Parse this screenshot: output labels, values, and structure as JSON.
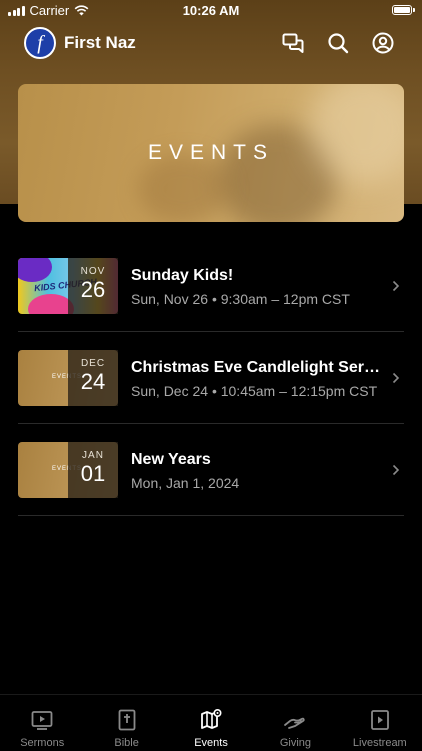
{
  "status_bar": {
    "carrier": "Carrier",
    "time": "10:26 AM"
  },
  "header": {
    "logo_letter": "f",
    "app_title": "First Naz",
    "icons": [
      "chat-icon",
      "search-icon",
      "profile-icon"
    ]
  },
  "banner": {
    "title": "EVENTS"
  },
  "events": [
    {
      "month": "NOV",
      "day": "26",
      "title": "Sunday Kids!",
      "subtitle": "Sun, Nov 26 • 9:30am – 12pm CST",
      "thumb_text": "KIDS CHURCH"
    },
    {
      "month": "DEC",
      "day": "24",
      "title": "Christmas Eve Candlelight Service",
      "subtitle": "Sun, Dec 24 • 10:45am – 12:15pm CST",
      "thumb_text": "EVENTS"
    },
    {
      "month": "JAN",
      "day": "01",
      "title": "New Years",
      "subtitle": "Mon, Jan 1, 2024",
      "thumb_text": "EVENTS"
    }
  ],
  "tabs": [
    {
      "label": "Sermons",
      "icon": "sermons-icon",
      "active": false
    },
    {
      "label": "Bible",
      "icon": "bible-icon",
      "active": false
    },
    {
      "label": "Events",
      "icon": "map-icon",
      "active": true
    },
    {
      "label": "Giving",
      "icon": "giving-icon",
      "active": false
    },
    {
      "label": "Livestream",
      "icon": "livestream-icon",
      "active": false
    }
  ],
  "colors": {
    "header_gradient": "#6e4f22",
    "logo_blue": "#1e3fa8",
    "subtitle_gray": "#a9a9a9",
    "tab_inactive": "#8a8a8a"
  }
}
